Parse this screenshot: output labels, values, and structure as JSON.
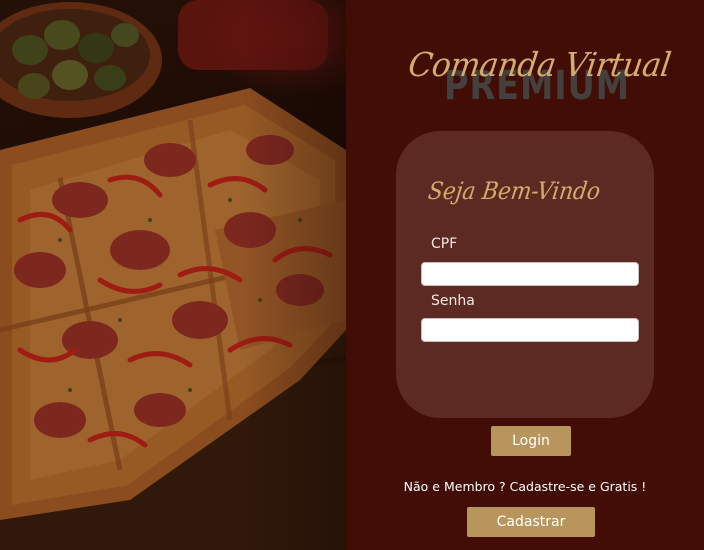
{
  "brand": {
    "title": "Comanda Virtual",
    "subtitle": "PREMIUM"
  },
  "login_card": {
    "welcome": "Seja Bem-Vindo",
    "cpf_label": "CPF",
    "cpf_value": "",
    "senha_label": "Senha",
    "senha_value": ""
  },
  "actions": {
    "login_label": "Login",
    "signup_prompt": "Não e Membro ? Cadastre-se e Gratis !",
    "signup_label": "Cadastrar"
  },
  "colors": {
    "background": "#410d06",
    "card": "#5d2a23",
    "accent_gold": "#d3ad6c",
    "button": "#b8955c"
  },
  "photo": {
    "subject": "pizza-photo"
  }
}
